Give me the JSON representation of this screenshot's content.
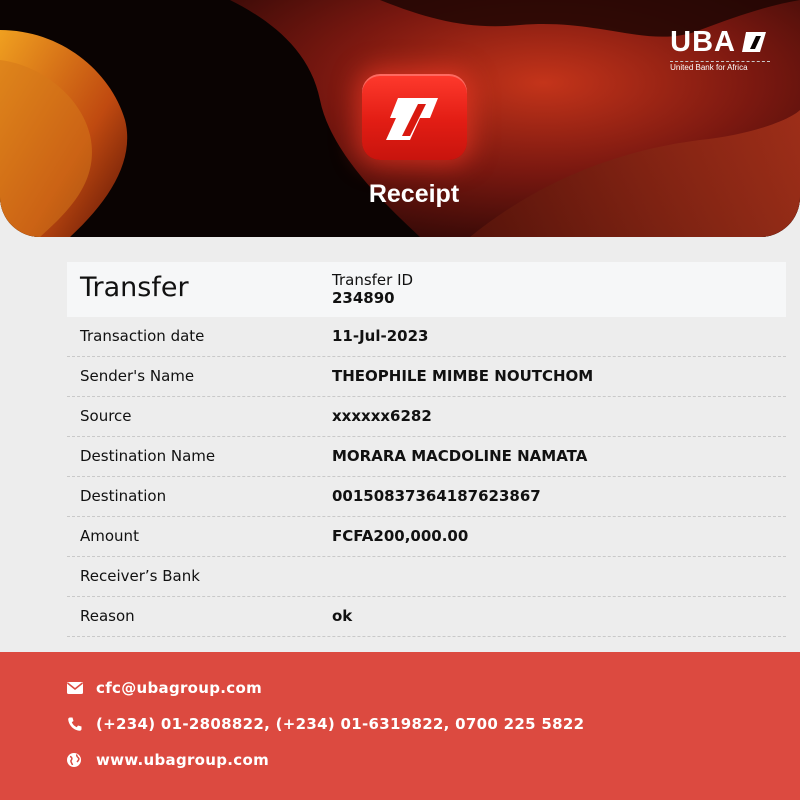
{
  "header": {
    "brand": "UBA",
    "tagline": "United Bank for Africa",
    "title": "Receipt",
    "app_icon": "uba-app-icon"
  },
  "transfer": {
    "type": "Transfer",
    "id_label": "Transfer ID",
    "id_value": "234890",
    "rows": [
      {
        "label": "Transaction date",
        "value": "11-Jul-2023"
      },
      {
        "label": "Sender's Name",
        "value": "THEOPHILE MIMBE NOUTCHOM"
      },
      {
        "label": "Source",
        "value": "xxxxxx6282"
      },
      {
        "label": "Destination Name",
        "value": "MORARA MACDOLINE NAMATA"
      },
      {
        "label": "Destination",
        "value": "00150837364187623867"
      },
      {
        "label": "Amount",
        "value": "FCFA200,000.00"
      },
      {
        "label": "Receiver’s Bank",
        "value": ""
      },
      {
        "label": "Reason",
        "value": "ok"
      }
    ]
  },
  "footer": {
    "email": "cfc@ubagroup.com",
    "phone": "(+234) 01-2808822, (+234) 01-6319822, 0700 225 5822",
    "website": "www.ubagroup.com",
    "icons": [
      "envelope-icon",
      "phone-icon",
      "globe-icon"
    ]
  },
  "colors": {
    "brand_red": "#e21d14",
    "footer_red": "#dc4a40",
    "header_dark": "#0a0302"
  }
}
